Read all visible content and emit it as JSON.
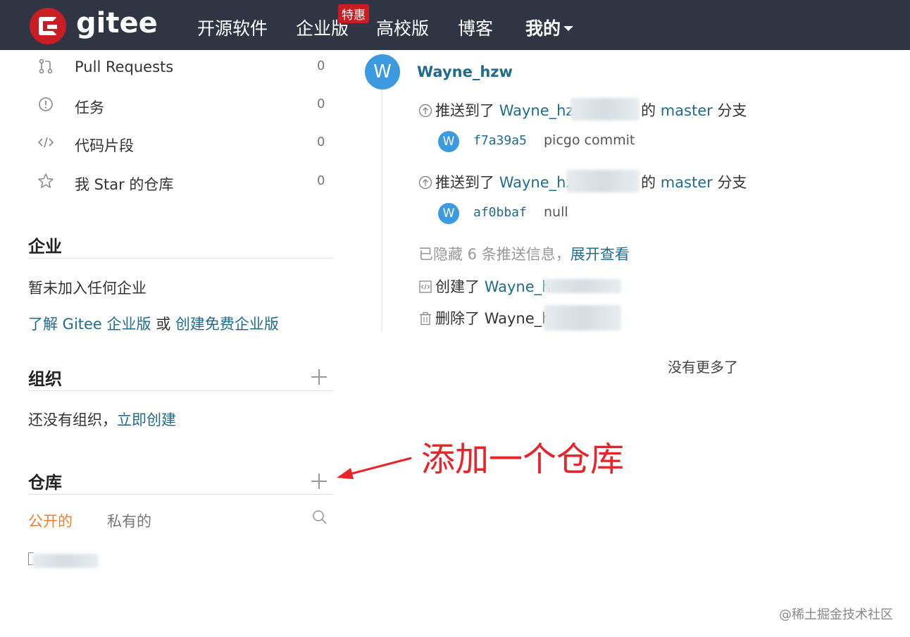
{
  "header": {
    "logo_text": "gitee",
    "nav": [
      "开源软件",
      "企业版",
      "高校版",
      "博客",
      "我的"
    ],
    "badge": "特惠"
  },
  "sidebar": {
    "items": [
      {
        "label": "Pull Requests",
        "count": "0",
        "icon": "pull-request-icon"
      },
      {
        "label": "任务",
        "count": "0",
        "icon": "issue-icon"
      },
      {
        "label": "代码片段",
        "count": "0",
        "icon": "code-icon"
      },
      {
        "label": "我 Star 的仓库",
        "count": "0",
        "icon": "star-icon"
      }
    ],
    "enterprise": {
      "title": "企业",
      "empty": "暂未加入任何企业",
      "link1": "了解 Gitee 企业版",
      "or": "或",
      "link2": "创建免费企业版"
    },
    "orgs": {
      "title": "组织",
      "empty": "还没有组织，",
      "create": "立即创建"
    },
    "repos": {
      "title": "仓库",
      "tab_public": "公开的",
      "tab_private": "私有的"
    }
  },
  "feed": {
    "user": "Wayne_hzw",
    "avatar_letter": "W",
    "events": [
      {
        "action": "推送到了",
        "repo": "Wayne_hz",
        "of": "的",
        "branch": "master",
        "suffix": "分支",
        "sha": "f7a39a5",
        "message": "picgo commit"
      },
      {
        "action": "推送到了",
        "repo": "Wayne_hz",
        "of": "的",
        "branch": "master",
        "suffix": "分支",
        "sha": "af0bbaf",
        "message": "null"
      }
    ],
    "hidden_text": "已隐藏 6 条推送信息，",
    "expand": "展开查看",
    "created": {
      "action": "创建了",
      "repo": "Wayne_h"
    },
    "deleted": {
      "action": "删除了",
      "repo": "Wayne_h"
    },
    "no_more": "没有更多了"
  },
  "annotation": "添加一个仓库",
  "watermark": "@稀土掘金技术社区",
  "colors": {
    "nav_bg": "#2f3542",
    "brand": "#c71d23",
    "link": "#1f6c8c",
    "active_tab": "#f0812c",
    "annotation": "#e8242a"
  }
}
